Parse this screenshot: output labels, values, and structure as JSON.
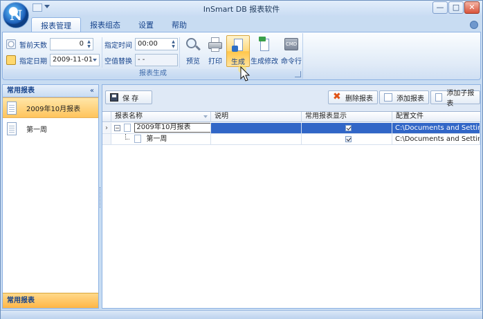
{
  "window": {
    "title": "InSmart DB 报表软件",
    "minimize": "—",
    "maximize": "□",
    "close": "✕"
  },
  "tabs": [
    {
      "label": "报表管理",
      "active": true
    },
    {
      "label": "报表组态",
      "active": false
    },
    {
      "label": "设置",
      "active": false
    },
    {
      "label": "帮助",
      "active": false
    }
  ],
  "ribbon": {
    "fields": {
      "days_label": "暂前天数",
      "days_value": "0",
      "date_label": "指定日期",
      "date_value": "2009-11-01",
      "time_label": "指定时间",
      "time_value": "00:00",
      "blank_label": "空值替换",
      "blank_value": "- -"
    },
    "buttons": {
      "preview": "预览",
      "print": "打印",
      "generate": "生成",
      "generate_modify": "生成修改",
      "command": "命令行",
      "cmd_icon_text": "CMD"
    },
    "group_title": "报表生成"
  },
  "left_panel": {
    "header": "常用报表",
    "collapse": "«",
    "items": [
      {
        "label": "2009年10月报表",
        "selected": true
      },
      {
        "label": "第一周",
        "selected": false
      }
    ],
    "footer": "常用报表"
  },
  "toolbar": {
    "save": "保 存",
    "delete": "删除报表",
    "add": "添加报表",
    "add_child": "添加子报表"
  },
  "grid": {
    "columns": [
      "报表名称",
      "说明",
      "常用报表显示",
      "配置文件"
    ],
    "rows": [
      {
        "name": "2009年10月报表",
        "desc": "",
        "show": true,
        "config": "C:\\Documents and Setting...",
        "selected": true
      },
      {
        "name": "第一周",
        "desc": "",
        "show": true,
        "config": "C:\\Documents and Setting...",
        "selected": false
      }
    ]
  },
  "colors": {
    "accent": "#ffc45c",
    "selection": "#3166c7",
    "header": "#15428b"
  }
}
